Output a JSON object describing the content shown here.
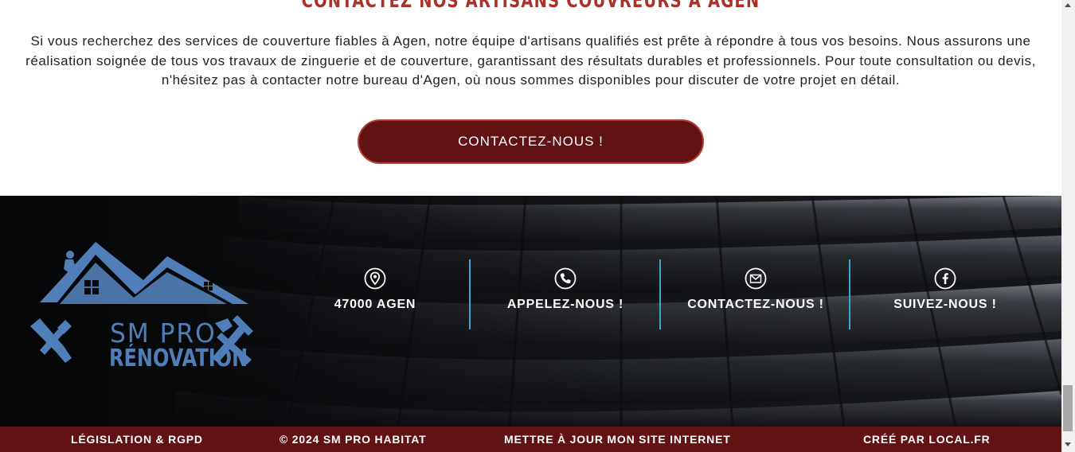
{
  "section": {
    "title": "CONTACTEZ NOS ARTISANS COUVREURS À AGEN",
    "paragraph": "Si vous recherchez des services de couverture fiables à Agen, notre équipe d'artisans qualifiés est prête à répondre à tous vos besoins. Nous assurons une réalisation soignée de tous vos travaux de zinguerie et de couverture, garantissant des résultats durables et professionnels. Pour toute consultation ou devis, n'hésitez pas à contacter notre bureau d'Agen, où nous sommes disponibles pour discuter de votre projet en détail.",
    "cta_label": "CONTACTEZ-NOUS !"
  },
  "footer": {
    "logo": {
      "line1": "SM PRO",
      "line2": "RÉNOVATION",
      "color": "#4f7eb9"
    },
    "contacts": [
      {
        "icon": "location-pin-icon",
        "label": "47000 AGEN"
      },
      {
        "icon": "phone-icon",
        "label": "APPELEZ-NOUS !"
      },
      {
        "icon": "mail-icon",
        "label": "CONTACTEZ-NOUS !"
      },
      {
        "icon": "facebook-icon",
        "label": "SUIVEZ-NOUS !"
      }
    ],
    "divider_color": "#3aa7d4"
  },
  "bottom_bar": {
    "links": [
      "LÉGISLATION & RGPD",
      "© 2024 SM PRO HABITAT",
      "METTRE À JOUR MON SITE INTERNET",
      "CRÉÉ PAR LOCAL.FR"
    ],
    "background": "#621114"
  },
  "colors": {
    "accent_red": "#621114",
    "title_red": "#a8322a",
    "button_border": "#b3412e"
  }
}
